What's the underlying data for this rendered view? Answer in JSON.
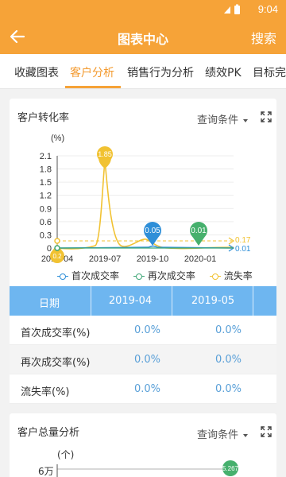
{
  "status": {
    "time": "9:04"
  },
  "appbar": {
    "title": "图表中心",
    "action": "搜索"
  },
  "tabs": [
    {
      "label": "收藏图表",
      "active": false
    },
    {
      "label": "客户分析",
      "active": true
    },
    {
      "label": "销售行为分析",
      "active": false
    },
    {
      "label": "绩效PK",
      "active": false
    },
    {
      "label": "目标完",
      "active": false
    }
  ],
  "card1": {
    "title": "客户转化率",
    "query": "查询条件",
    "yunit": "(%)"
  },
  "chart_data": {
    "type": "line",
    "title": "客户转化率",
    "ylabel": "(%)",
    "ylim": [
      0,
      2.1
    ],
    "yticks": [
      "2.1",
      "1.8",
      "1.5",
      "1.2",
      "0.9",
      "0.6",
      "0.3",
      "0"
    ],
    "xticks": [
      "2019-04",
      "2019-07",
      "2019-10",
      "2020-01"
    ],
    "series": [
      {
        "name": "首次成交率",
        "color": "#2f8fd8",
        "peak_label": "0.05",
        "last_label": "0.01"
      },
      {
        "name": "再次成交率",
        "color": "#3fa777",
        "peak_label": "0.01"
      },
      {
        "name": "流失率",
        "color": "#f1c232",
        "peak_label": "1.85",
        "start_label": "0.2",
        "last_label": "0.17"
      }
    ],
    "annotations": [
      "1.85",
      "0.05",
      "0.01",
      "0.17",
      "0.01",
      "0.2"
    ]
  },
  "table": {
    "headers": [
      "日期",
      "2019-04",
      "2019-05"
    ],
    "rows": [
      {
        "label": "首次成交率(%)",
        "values": [
          "0.0%",
          "0.0%"
        ]
      },
      {
        "label": "再次成交率(%)",
        "values": [
          "0.0%",
          "0.0%"
        ]
      },
      {
        "label": "流失率(%)",
        "values": [
          "0.0%",
          "0.0%"
        ]
      }
    ]
  },
  "card2": {
    "title": "客户总量分析",
    "query": "查询条件",
    "yunit": "(个)",
    "ytick": "6万",
    "badge": "5.267"
  },
  "colors": {
    "accent": "#f6a338",
    "tab_active": "#f39a2f",
    "table_header": "#6eb6f0",
    "value_text": "#5aa0d8"
  }
}
